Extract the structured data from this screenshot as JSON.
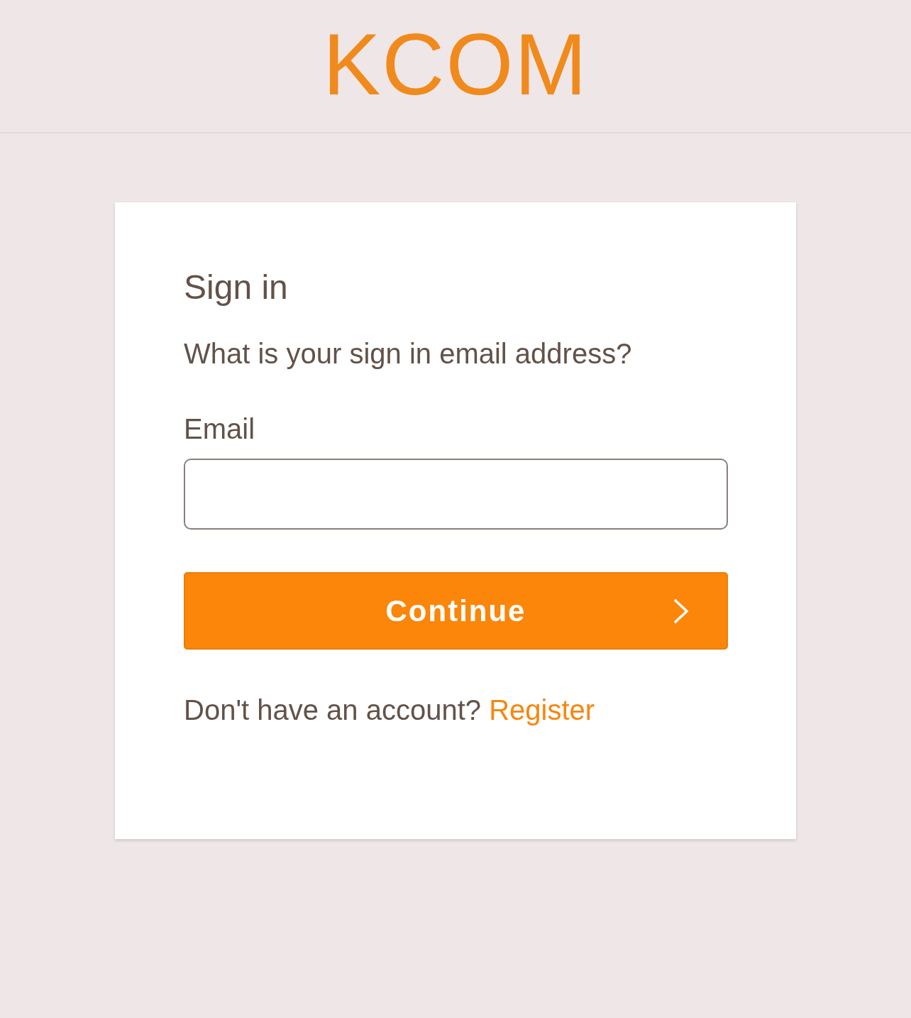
{
  "header": {
    "logo": "KCOM"
  },
  "card": {
    "title": "Sign in",
    "prompt": "What is your sign in email address?",
    "email_field": {
      "label": "Email"
    },
    "continue_button": {
      "label": "Continue"
    },
    "register_prompt": {
      "text": "Don't have an account?",
      "link": "Register"
    }
  }
}
